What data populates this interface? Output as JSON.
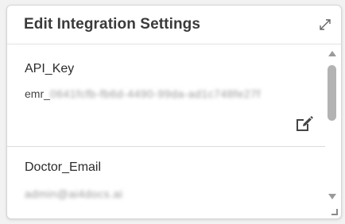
{
  "dialog": {
    "title": "Edit Integration Settings"
  },
  "fields": [
    {
      "label": "API_Key",
      "value_prefix": "emr_",
      "value_masked": "0641fcfb-fb6d-4490-99da-ad1c748fe27f"
    },
    {
      "label": "Doctor_Email",
      "value_masked": "admin@ai4docs.ai"
    }
  ],
  "icons": {
    "expand": "expand-icon",
    "edit": "edit-pencil-icon",
    "resize": "resize-grip-icon"
  },
  "colors": {
    "title_text": "#3a3a3a",
    "divider": "#dcdcdc",
    "scrollbar_thumb": "#b3b3b3",
    "edit_icon": "#444444"
  }
}
